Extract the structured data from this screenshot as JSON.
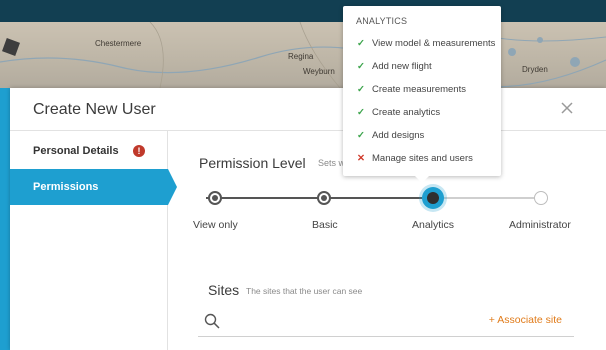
{
  "modal": {
    "title": "Create New User"
  },
  "map": {
    "towns": [
      "Chestermere",
      "Regina",
      "Weyburn",
      "Dryden"
    ]
  },
  "sidebar": {
    "items": [
      {
        "label": "Personal Details",
        "error_badge": "!"
      },
      {
        "label": "Permissions"
      }
    ]
  },
  "permission": {
    "title": "Permission Level",
    "subtitle": "Sets wha",
    "levels": [
      "View only",
      "Basic",
      "Analytics",
      "Administrator"
    ],
    "selected": "Analytics"
  },
  "sites": {
    "title": "Sites",
    "subtitle": "The sites that the user can see",
    "associate_label": "+ Associate site"
  },
  "popover": {
    "heading": "ANALYTICS",
    "items": [
      {
        "label": "View model & measurements",
        "allowed": true
      },
      {
        "label": "Add new flight",
        "allowed": true
      },
      {
        "label": "Create measurements",
        "allowed": true
      },
      {
        "label": "Create analytics",
        "allowed": true
      },
      {
        "label": "Add designs",
        "allowed": true
      },
      {
        "label": "Manage sites and users",
        "allowed": false
      }
    ]
  },
  "colors": {
    "accent": "#1e9fd0",
    "link": "#e07b1a",
    "error": "#c0392b",
    "allowed": "#3aa34a",
    "denied": "#d03a2a"
  }
}
